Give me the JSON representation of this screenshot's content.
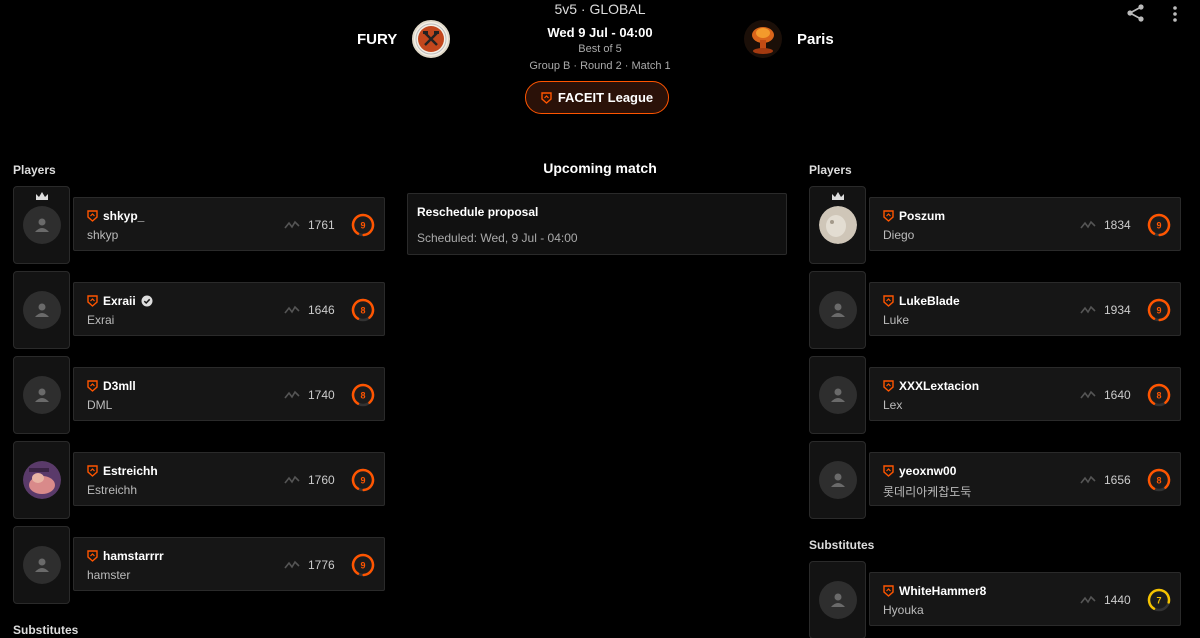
{
  "match": {
    "mode": "5v5 · GLOBAL",
    "date": "Wed 9 Jul - 04:00",
    "best_of": "Best of 5",
    "group_info": "Group B · Round 2 · Match 1",
    "league_label": "FACEIT League"
  },
  "teams": {
    "team1": {
      "name": "FURY"
    },
    "team2": {
      "name": "Paris"
    }
  },
  "left": {
    "players_title": "Players",
    "substitutes_title": "Substitutes",
    "players": [
      {
        "nick": "shkyp_",
        "name": "shkyp",
        "elo": "1761",
        "level": "9"
      },
      {
        "nick": "Exraii",
        "name": "Exrai",
        "elo": "1646",
        "level": "8"
      },
      {
        "nick": "D3mll",
        "name": "DML",
        "elo": "1740",
        "level": "8"
      },
      {
        "nick": "Estreichh",
        "name": "Estreichh",
        "elo": "1760",
        "level": "9"
      },
      {
        "nick": "hamstarrrr",
        "name": "hamster",
        "elo": "1776",
        "level": "9"
      }
    ]
  },
  "center": {
    "title": "Upcoming match",
    "reschedule_title": "Reschedule proposal",
    "reschedule_sub": "Scheduled: Wed, 9 Jul - 04:00"
  },
  "right": {
    "players_title": "Players",
    "substitutes_title": "Substitutes",
    "players": [
      {
        "nick": "Poszum",
        "name": "Diego",
        "elo": "1834",
        "level": "9"
      },
      {
        "nick": "LukeBlade",
        "name": "Luke",
        "elo": "1934",
        "level": "9"
      },
      {
        "nick": "XXXLextacion",
        "name": "Lex",
        "elo": "1640",
        "level": "8"
      },
      {
        "nick": "yeoxnw00",
        "name": "롯데리아케찹도둑",
        "elo": "1656",
        "level": "8"
      }
    ],
    "substitutes": [
      {
        "nick": "WhiteHammer8",
        "name": "Hyouka",
        "elo": "1440",
        "level": "7"
      }
    ]
  },
  "colors": {
    "accent": "#ff5500",
    "level_orange": "#ff5500",
    "level_yellow": "#f5c300"
  }
}
